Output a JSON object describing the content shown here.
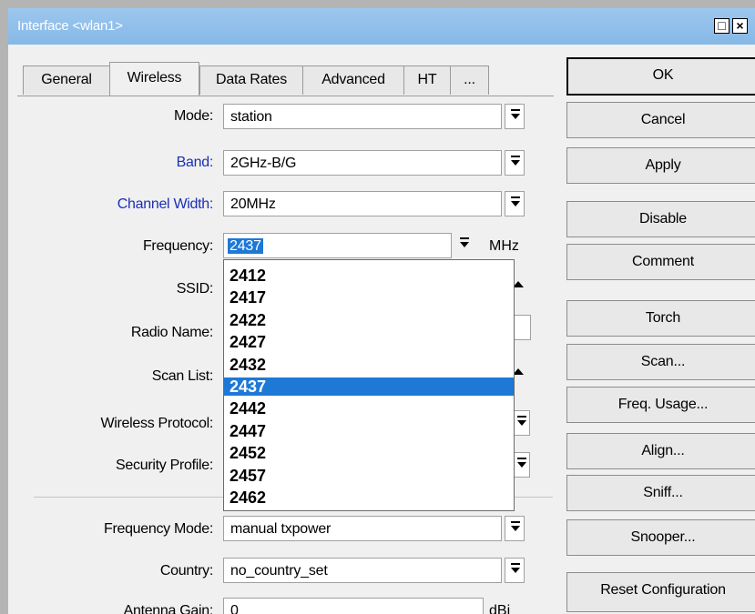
{
  "window": {
    "title": "Interface <wlan1>",
    "restore_glyph": "□",
    "close_glyph": "×"
  },
  "tabs": [
    {
      "label": "General",
      "active": false
    },
    {
      "label": "Wireless",
      "active": true
    },
    {
      "label": "Data Rates",
      "active": false
    },
    {
      "label": "Advanced",
      "active": false
    },
    {
      "label": "HT",
      "active": false
    },
    {
      "label": "...",
      "active": false
    }
  ],
  "form": {
    "mode": {
      "label": "Mode:",
      "value": "station"
    },
    "band": {
      "label": "Band:",
      "value": "2GHz-B/G"
    },
    "channel_width": {
      "label": "Channel Width:",
      "value": "20MHz"
    },
    "frequency": {
      "label": "Frequency:",
      "value": "2437",
      "unit": "MHz"
    },
    "ssid": {
      "label": "SSID:"
    },
    "radio_name": {
      "label": "Radio Name:"
    },
    "scan_list": {
      "label": "Scan List:"
    },
    "wireless_protocol": {
      "label": "Wireless Protocol:"
    },
    "security_profile": {
      "label": "Security Profile:"
    },
    "frequency_mode": {
      "label": "Frequency Mode:",
      "value": "manual txpower"
    },
    "country": {
      "label": "Country:",
      "value": "no_country_set"
    },
    "antenna_gain": {
      "label": "Antenna Gain:",
      "value": "0",
      "unit": "dBi"
    }
  },
  "frequency_options": [
    "2412",
    "2417",
    "2422",
    "2427",
    "2432",
    "2437",
    "2442",
    "2447",
    "2452",
    "2457",
    "2462"
  ],
  "frequency_selected": "2437",
  "buttons": {
    "ok": "OK",
    "cancel": "Cancel",
    "apply": "Apply",
    "disable": "Disable",
    "comment": "Comment",
    "torch": "Torch",
    "scan": "Scan...",
    "freq_usage": "Freq. Usage...",
    "align": "Align...",
    "sniff": "Sniff...",
    "snooper": "Snooper...",
    "reset_configuration": "Reset Configuration"
  },
  "colors": {
    "titlebar": "#9cc7ee",
    "link_label": "#1b2fb8",
    "selection": "#1e78d6"
  }
}
